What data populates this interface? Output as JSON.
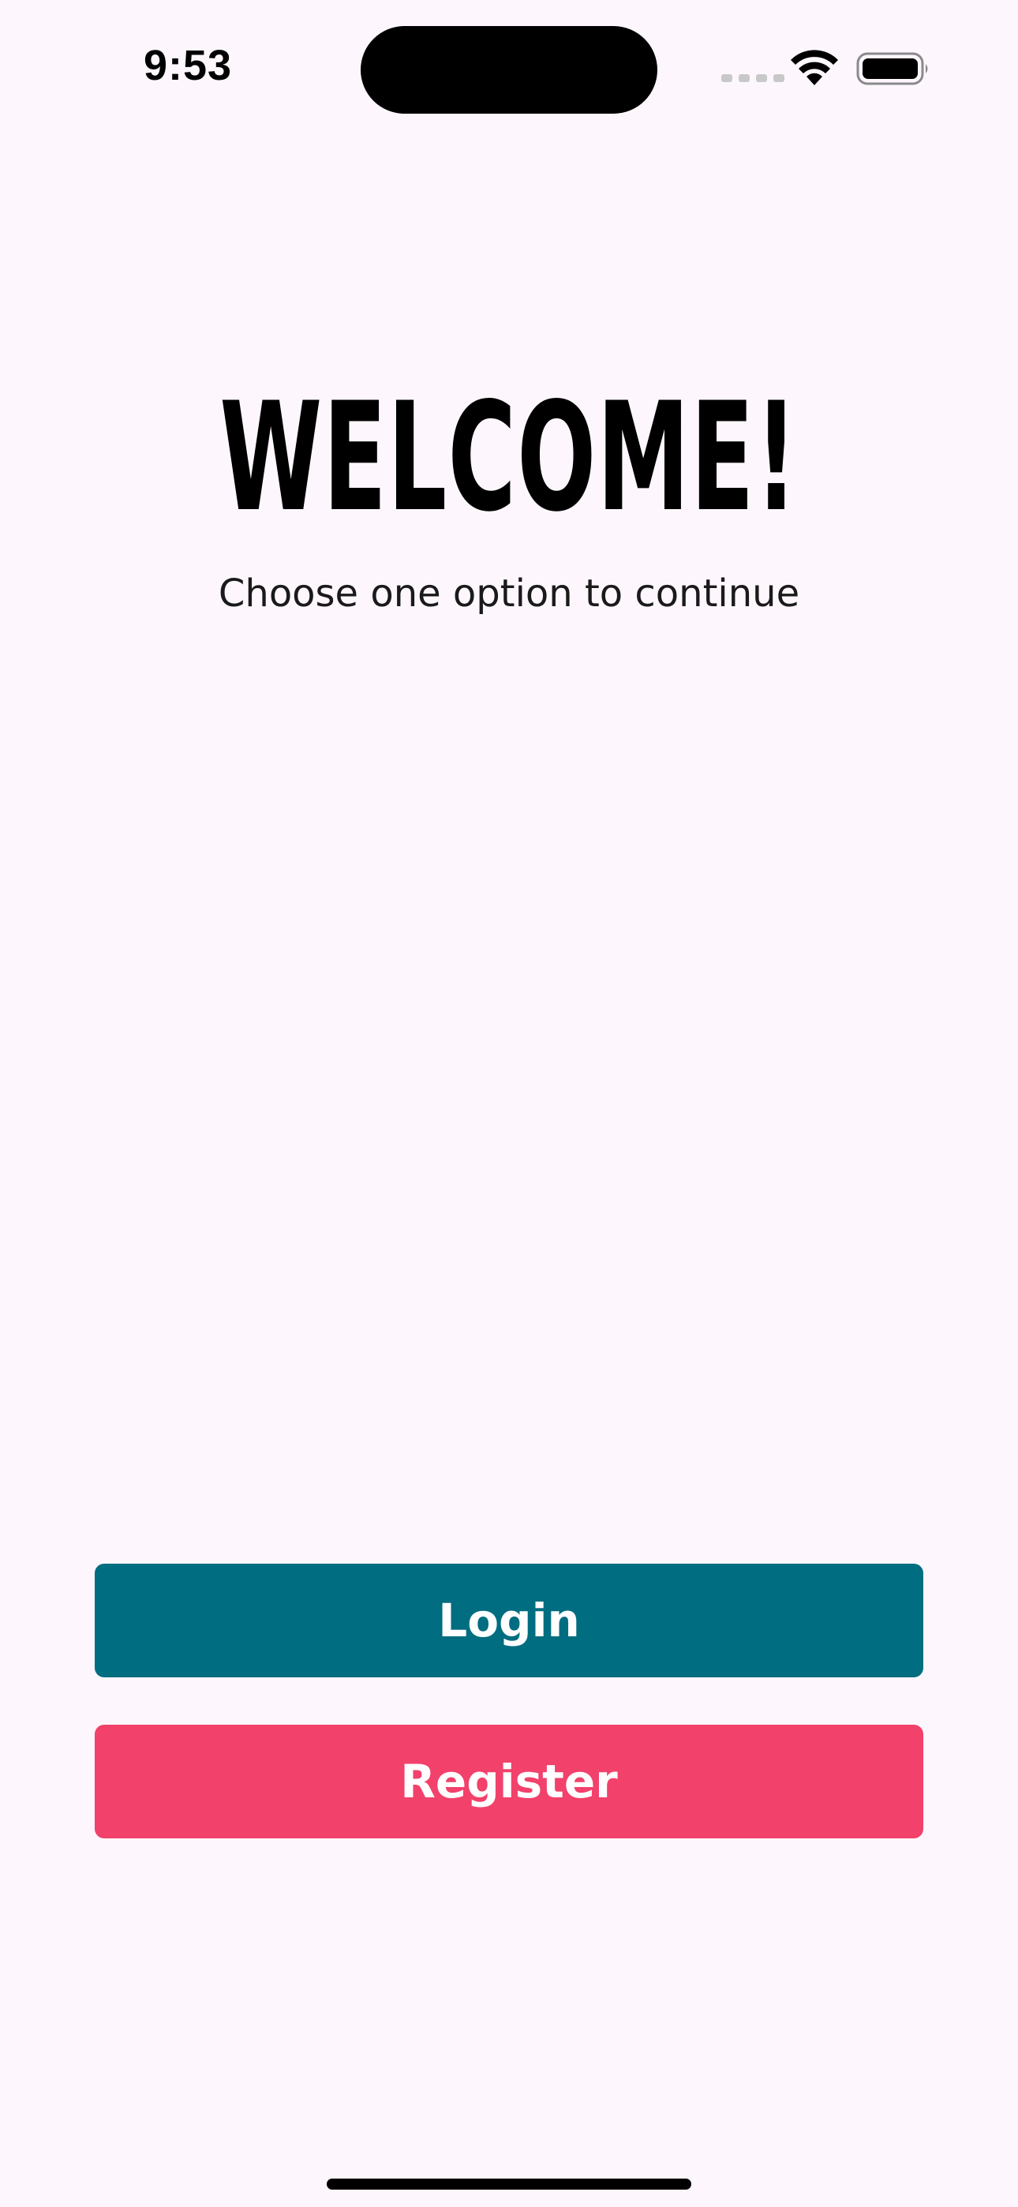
{
  "status_bar": {
    "time": "9:53",
    "wifi_icon": "wifi-icon",
    "battery_icon": "battery-icon",
    "signal_icon": "cellular-signal-icon"
  },
  "welcome": {
    "title": "WELCOME!",
    "subtitle": "Choose one option to continue"
  },
  "actions": {
    "login_label": "Login",
    "register_label": "Register"
  },
  "colors": {
    "background": "#fdf7fd",
    "login_button": "#006d80",
    "register_button": "#f2416b"
  }
}
